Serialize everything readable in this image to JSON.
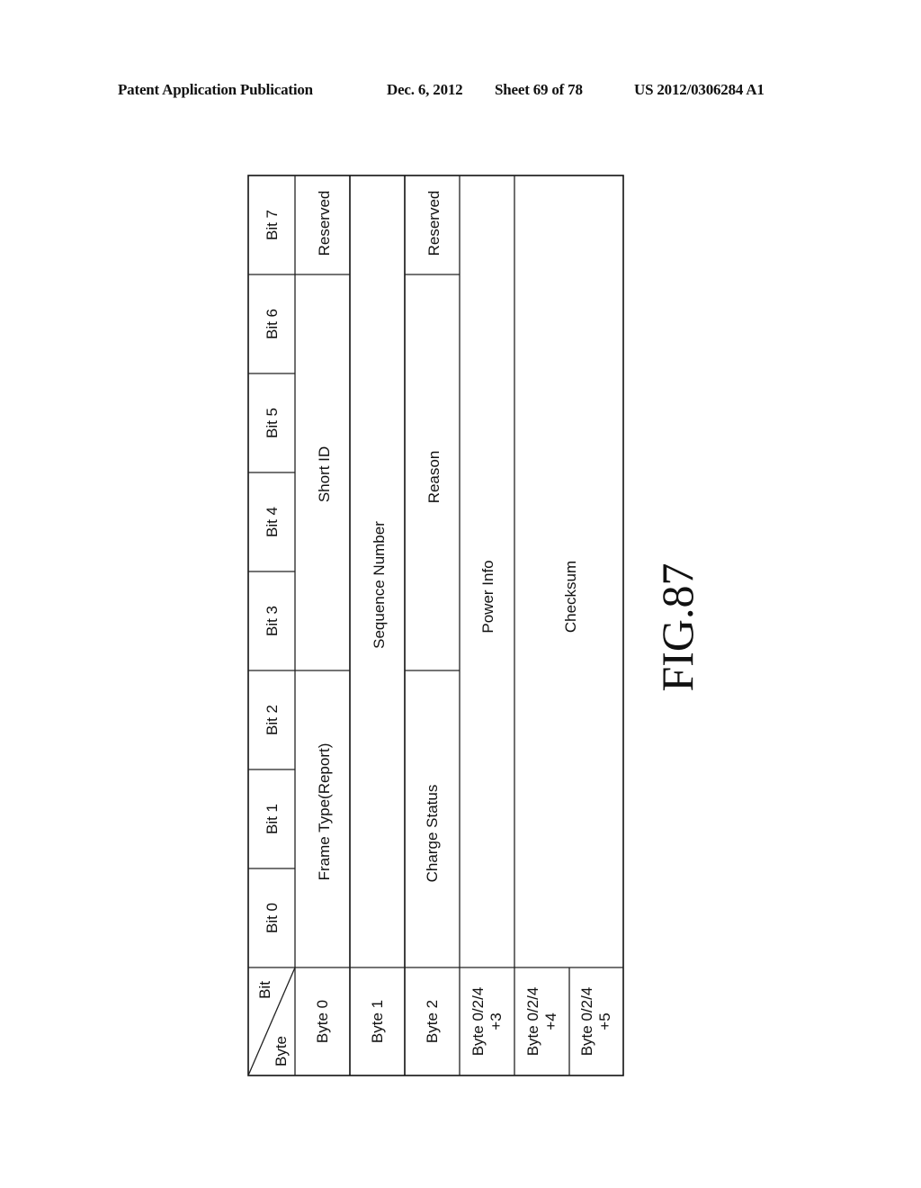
{
  "header": {
    "publication": "Patent Application Publication",
    "date": "Dec. 6, 2012",
    "sheet": "Sheet 69 of 78",
    "number": "US 2012/0306284 A1"
  },
  "table": {
    "corner": {
      "bit": "Bit",
      "byte": "Byte"
    },
    "bit_columns": [
      "Bit 0",
      "Bit 1",
      "Bit 2",
      "Bit 3",
      "Bit 4",
      "Bit 5",
      "Bit 6",
      "Bit 7"
    ],
    "rows": [
      {
        "byte": "Byte 0",
        "fields": [
          {
            "label": "Frame Type(Report)",
            "bits": "0-2"
          },
          {
            "label": "Short ID",
            "bits": "3-6"
          },
          {
            "label": "Reserved",
            "bits": "7"
          }
        ]
      },
      {
        "byte": "Byte 1",
        "fields": [
          {
            "label": "Sequence Number",
            "bits": "0-7"
          }
        ]
      },
      {
        "byte": "Byte 2",
        "fields": [
          {
            "label": "Charge Status",
            "bits": "0-2"
          },
          {
            "label": "Reason",
            "bits": "3-6"
          },
          {
            "label": "Reserved",
            "bits": "7"
          }
        ]
      },
      {
        "byte_line1": "Byte 0/2/4",
        "byte_line2": "+3",
        "fields": [
          {
            "label": "Power Info",
            "bits": "0-7"
          }
        ]
      },
      {
        "byte_line1": "Byte 0/2/4",
        "byte_line2": "+4",
        "fields": [
          {
            "label": "Checksum",
            "bits": "0-7"
          }
        ]
      },
      {
        "byte_line1": "Byte 0/2/4",
        "byte_line2": "+5",
        "fields": []
      }
    ]
  },
  "figure_label": "FIG.87"
}
